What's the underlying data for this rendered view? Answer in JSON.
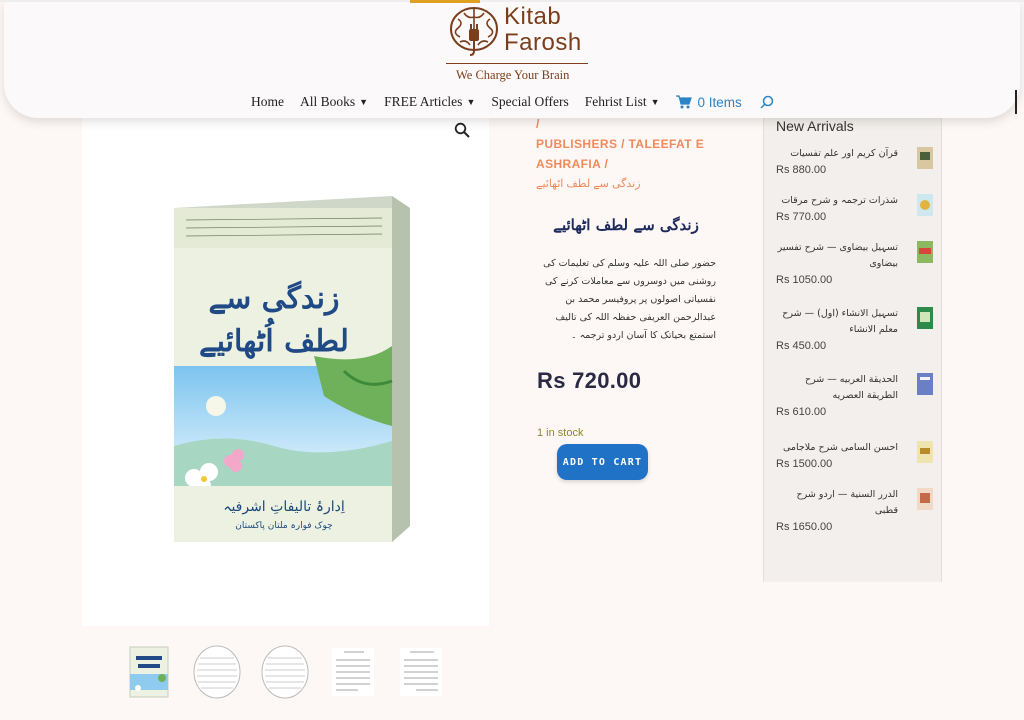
{
  "brand": {
    "name_line1": "Kitab",
    "name_line2": "Farosh",
    "tagline": "We Charge Your Brain"
  },
  "nav": {
    "items": [
      {
        "label": "Home",
        "has_dropdown": false
      },
      {
        "label": "All Books",
        "has_dropdown": true
      },
      {
        "label": "FREE Articles",
        "has_dropdown": true
      },
      {
        "label": "Special Offers",
        "has_dropdown": false
      },
      {
        "label": "Fehrist List",
        "has_dropdown": true
      }
    ],
    "cart_label": "0 Items"
  },
  "breadcrumb": {
    "partial_top": "HOME / ALL BOOKS / BOOKS /",
    "publishers": "PUBLISHERS / TALEEFAT E ASHRAFIA /",
    "current": "زندگی سے لطف اٹھائیے"
  },
  "product": {
    "title": "زندگی سے لطف اٹھائیے",
    "description": "حضور صلی اللہ علیہ وسلم کی تعلیمات کی روشنی میں دوسروں سے معاملات کرنے کی نفسیاتی اصولوں پر پروفیسر محمد بن عبدالرحمن العریفی حفظہ اللہ کی تالیف استمتع بحیاتک کا آسان اردو ترجمہ ۔",
    "price": "Rs 720.00",
    "stock": "1 in stock",
    "add_to_cart": "ADD TO CART",
    "cover": {
      "title_line1": "زندگی سے",
      "title_line2": "لطف اُٹھائیے",
      "publisher": "اِدارۂ تالیفاتِ اشرفیہ",
      "publisher_city": "چوک فوارہ ملتان پاکستان"
    }
  },
  "sidebar": {
    "title": "New Arrivals",
    "items": [
      {
        "name": "قرآن کریم اور علم تفسیات",
        "price": "Rs 880.00"
      },
      {
        "name": "شذرات ترجمہ و شرح مرقات",
        "price": "Rs 770.00"
      },
      {
        "name": "تسہیل بیضاوی — شرح تفسیر بیضاوی",
        "price": "Rs 1050.00"
      },
      {
        "name": "تسہیل الانشاء (اول) — شرح معلم الانشاء",
        "price": "Rs 450.00"
      },
      {
        "name": "الحدیقة العربیه — شرح الطریقة العصریه",
        "price": "Rs 610.00"
      },
      {
        "name": "احسن السامی شرح ملاجامی",
        "price": "Rs 1500.00"
      },
      {
        "name": "الدرر السنیة — اردو شرح قطبی",
        "price": "Rs 1650.00"
      }
    ]
  },
  "colors": {
    "accent_blue": "#1f72c5",
    "link_blue": "#2c84c6",
    "breadcrumb_orange": "#f08a5d",
    "brand_brown": "#7a3e1d",
    "price_dark": "#2b2a44"
  },
  "icons": {
    "zoom": "magnifier-icon",
    "cart": "cart-icon",
    "search": "search-icon"
  }
}
